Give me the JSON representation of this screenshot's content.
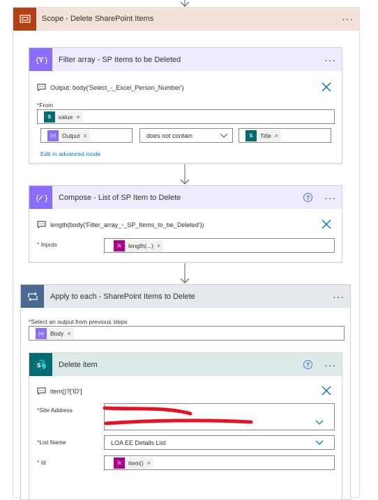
{
  "scope": {
    "title": "Scope - Delete SharePoint Items",
    "more": "···"
  },
  "filter": {
    "title": "Filter array - SP Items to be Deleted",
    "more": "···",
    "comment": "Output: body('Select_-_Excel_Person_Number')",
    "from_label": "From",
    "from_token": "value",
    "left_token": "Output",
    "operator": "does not contain",
    "right_token": "Title",
    "advanced_link": "Edit in advanced mode"
  },
  "compose": {
    "title": "Compose - List of SP Item to Delete",
    "more": "···",
    "help": "?",
    "comment": "length(body('Filter_array_-_SP_Items_to_be_Deleted'))",
    "inputs_label": "Inputs",
    "inputs_token": "length(...)"
  },
  "apply": {
    "title": "Apply to each - SharePoint Items to Delete",
    "more": "···",
    "select_label": "Select an output from previous steps",
    "select_token": "Body"
  },
  "delete": {
    "title": "Delete item",
    "more": "···",
    "help": "?",
    "comment": "item()?['ID']",
    "site_label": "Site Address",
    "list_label": "List Name",
    "list_value": "LOA EE Details List",
    "id_label": "Id",
    "id_token": "item()"
  },
  "common": {
    "required_mark": "*",
    "remove_mark": "×",
    "fx_mark": "fx"
  },
  "colors": {
    "scope_accent": "#b24215",
    "scope_header": "#f3e2d9",
    "data_op_accent": "#8c6cff",
    "data_op_header": "#eeeaff",
    "apply_accent": "#486991",
    "apply_header": "#e5e9ee",
    "sharepoint_accent": "#036c70",
    "sharepoint_header": "#dcebea",
    "expression_token": "#ad008c",
    "redaction": "#e81123"
  }
}
